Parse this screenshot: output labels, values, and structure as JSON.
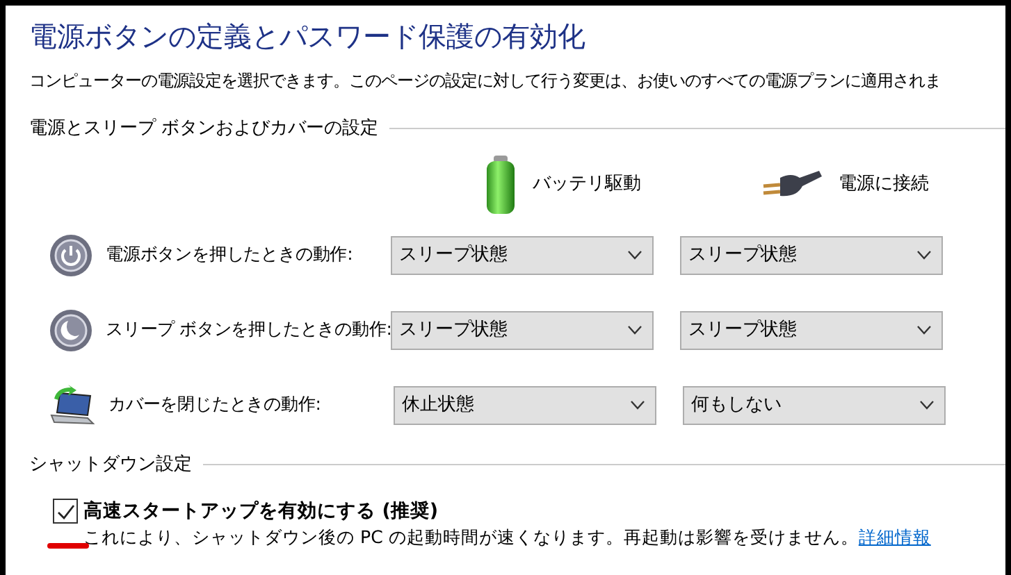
{
  "title": "電源ボタンの定義とパスワード保護の有効化",
  "description": "コンピューターの電源設定を選択できます。このページの設定に対して行う変更は、お使いのすべての電源プランに適用されま",
  "power_section": {
    "heading": "電源とスリープ ボタンおよびカバーの設定",
    "columns": [
      {
        "kind": "battery",
        "label": "バッテリ駆動"
      },
      {
        "kind": "plugged",
        "label": "電源に接続"
      }
    ],
    "rows": [
      {
        "kind": "power",
        "label": "電源ボタンを押したときの動作:",
        "values": [
          "スリープ状態",
          "スリープ状態"
        ]
      },
      {
        "kind": "sleep",
        "label": "スリープ ボタンを押したときの動作:",
        "values": [
          "スリープ状態",
          "スリープ状態"
        ]
      },
      {
        "kind": "lid",
        "label": "カバーを閉じたときの動作:",
        "values": [
          "休止状態",
          "何もしない"
        ]
      }
    ]
  },
  "shutdown_section": {
    "heading": "シャットダウン設定",
    "options": [
      {
        "label": "高速スタートアップを有効にする (推奨)",
        "checked": true,
        "description": "これにより、シャットダウン後の PC の起動時間が速くなります。再起動は影響を受けません。",
        "link": "詳細情報"
      }
    ]
  }
}
